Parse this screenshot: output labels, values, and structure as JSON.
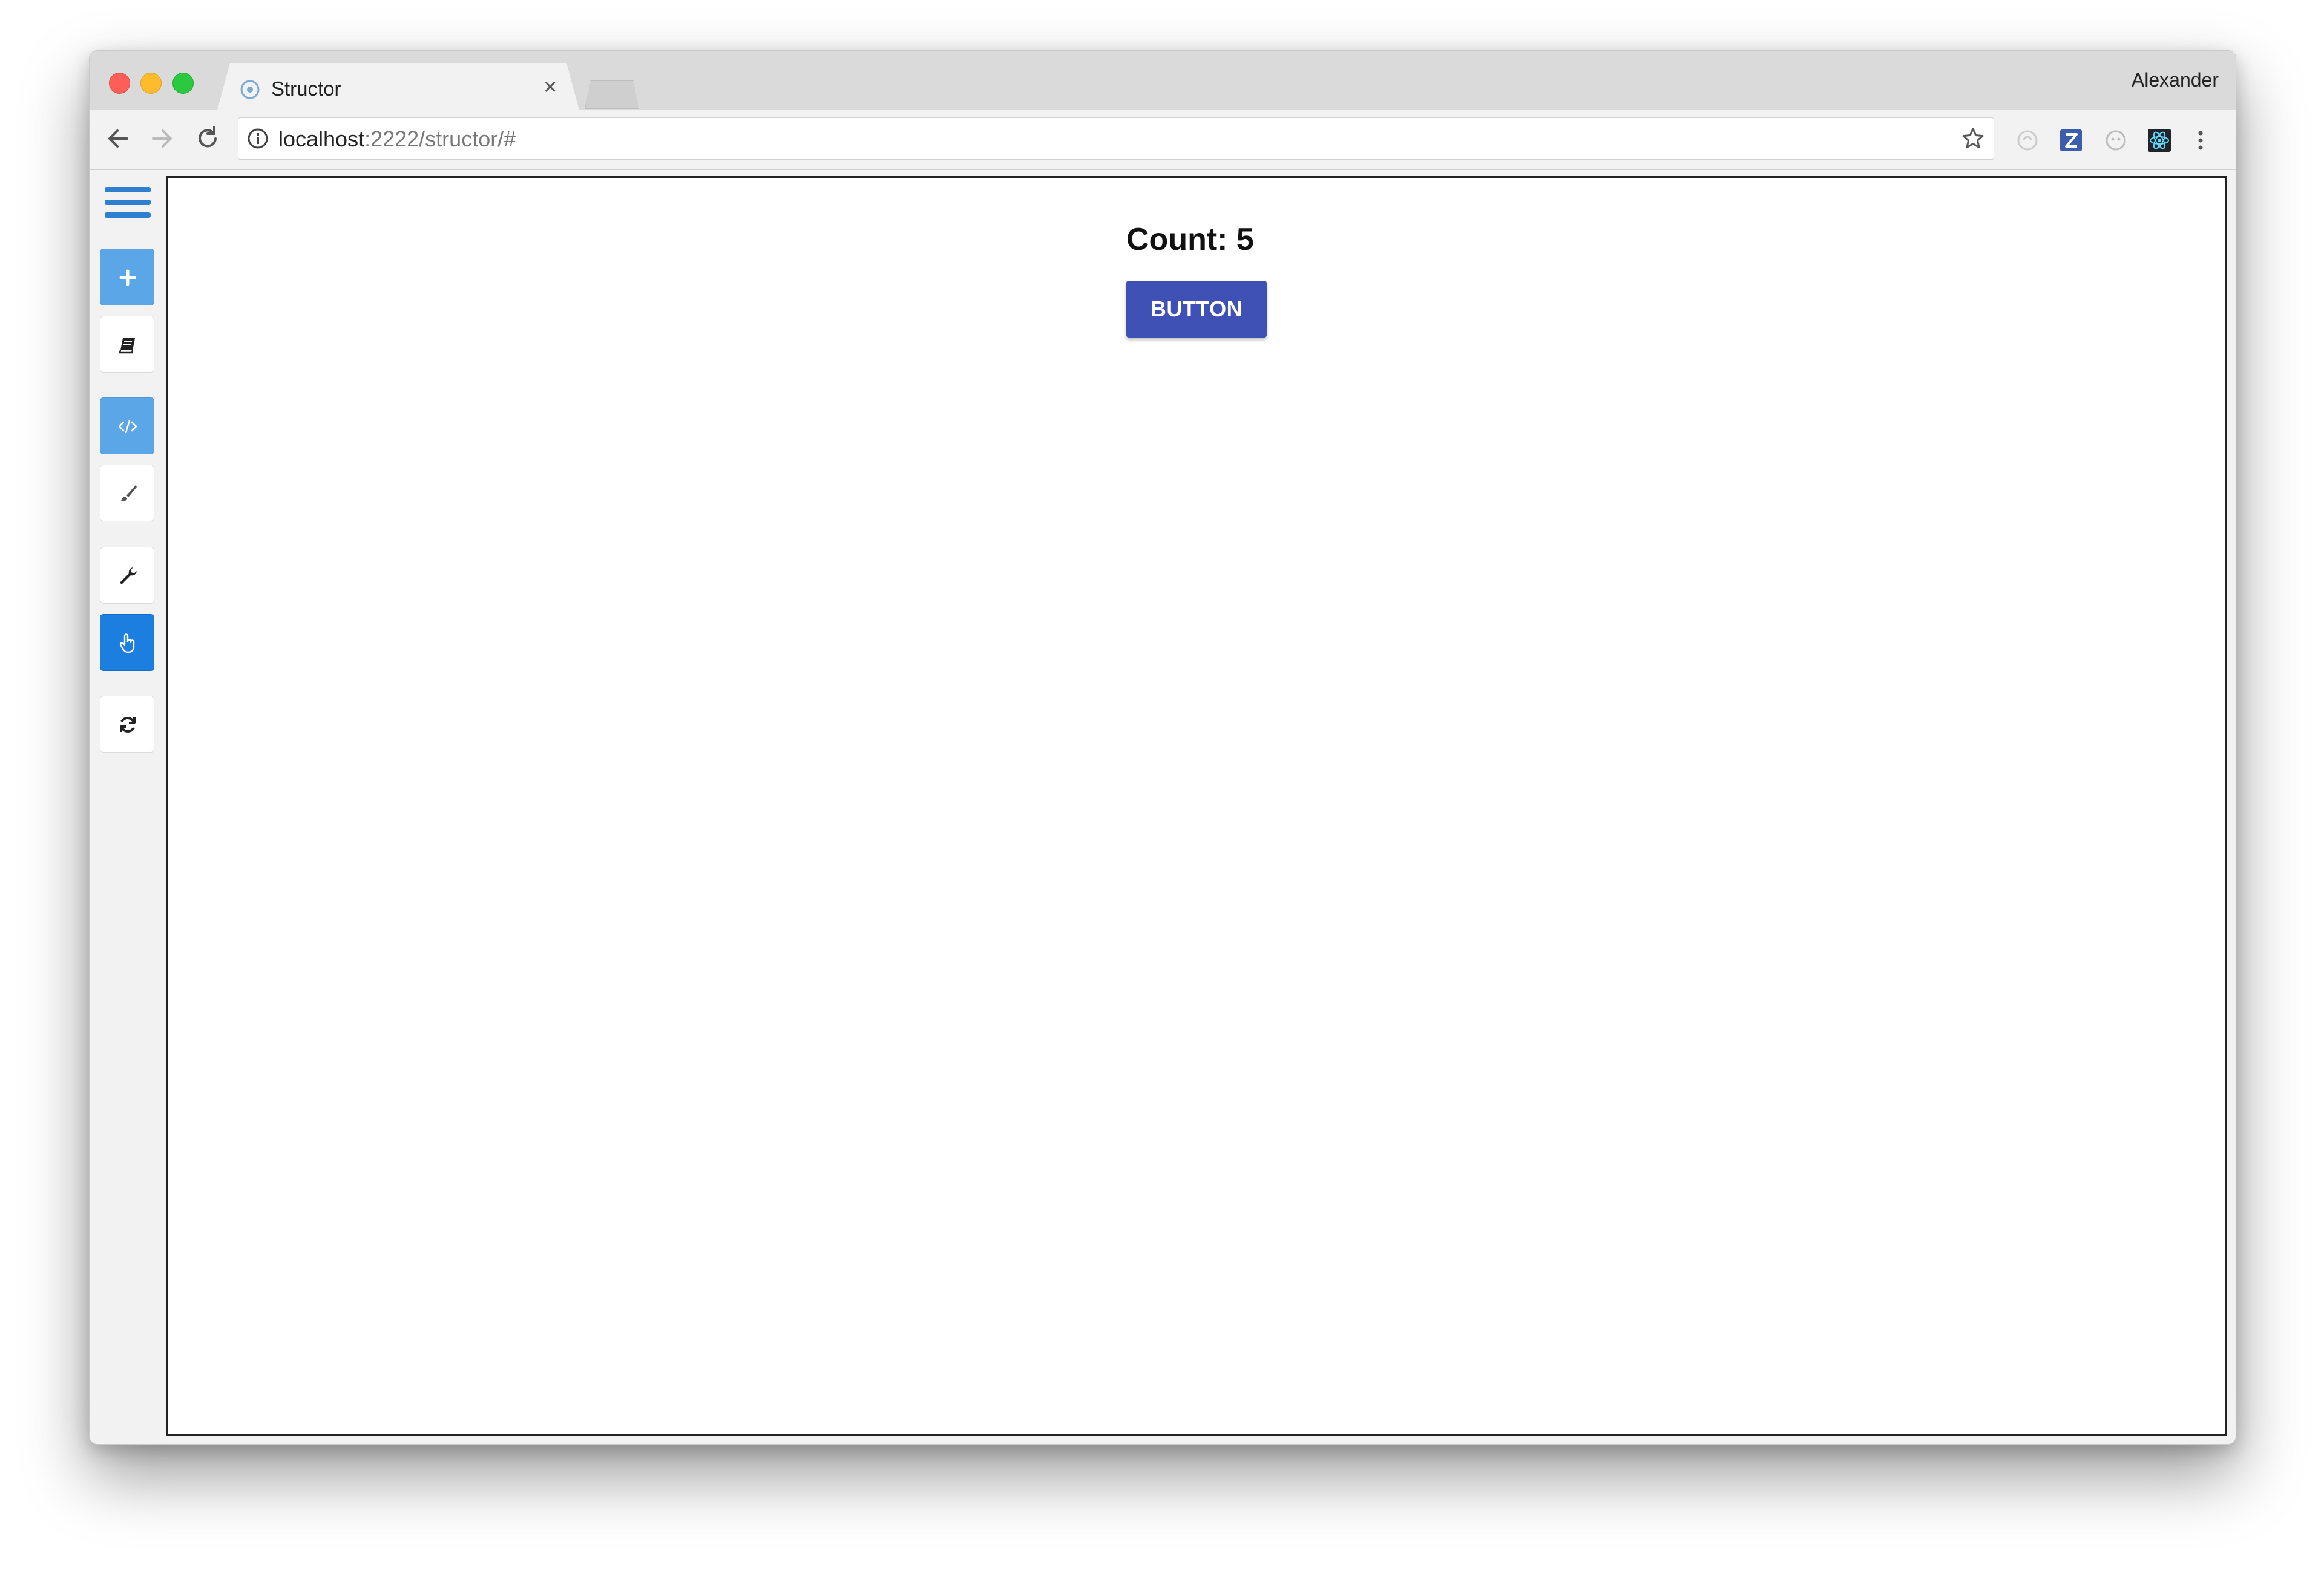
{
  "browser": {
    "tab_title": "Structor",
    "tab_close": "×",
    "profile_name": "Alexander",
    "url_host": "localhost",
    "url_rest": ":2222/structor/#"
  },
  "toolbar": {
    "icons": [
      "back-icon",
      "forward-icon",
      "reload-icon",
      "info-icon",
      "star-icon",
      "extension-icon",
      "zotero-icon",
      "ghost-icon",
      "react-devtools-icon",
      "menu-dots-icon"
    ]
  },
  "sidebar": {
    "items": [
      {
        "icon": "menu-icon"
      },
      {
        "icon": "plus-icon",
        "state": "active"
      },
      {
        "icon": "book-icon"
      },
      {
        "icon": "code-icon",
        "state": "active"
      },
      {
        "icon": "brush-icon"
      },
      {
        "icon": "wrench-icon"
      },
      {
        "icon": "pointer-hand-icon",
        "state": "selected"
      },
      {
        "icon": "refresh-icon"
      }
    ]
  },
  "page": {
    "count_text": "Count: 5",
    "button_label": "BUTTON"
  },
  "colors": {
    "accent": "#3f51b5",
    "sidebar_active": "#5aa6e6",
    "sidebar_selected": "#1c7fe0",
    "hamburger": "#2f7fd1"
  }
}
